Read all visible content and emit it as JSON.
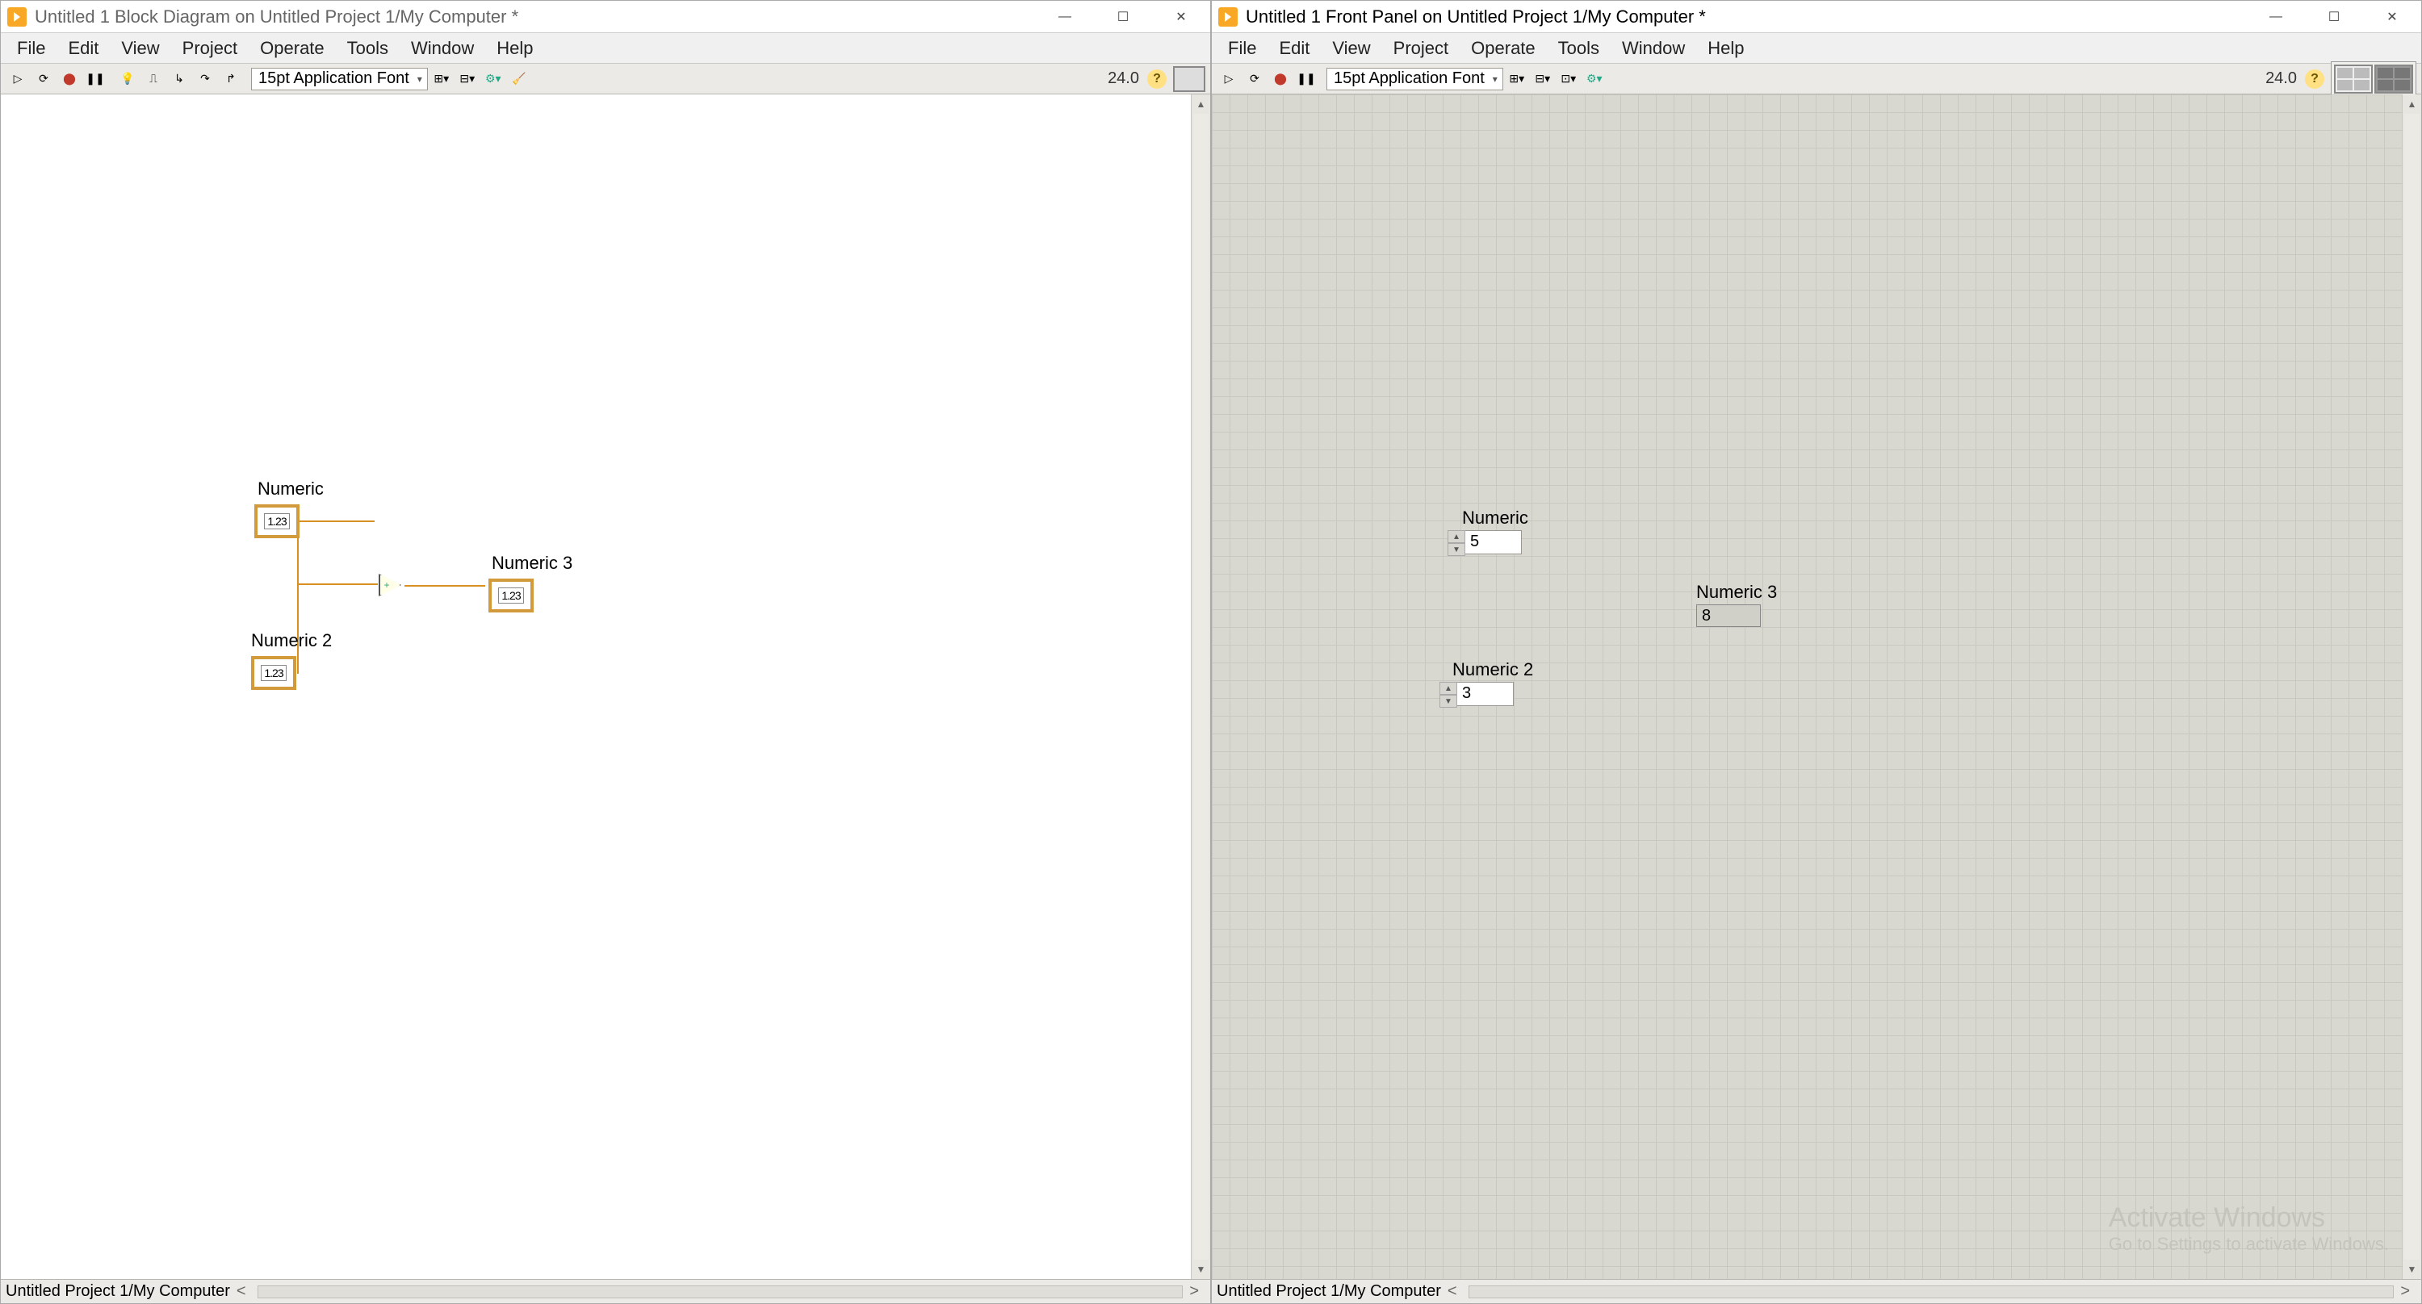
{
  "block_diagram": {
    "title": "Untitled 1 Block Diagram on Untitled Project 1/My Computer *",
    "menu": [
      "File",
      "Edit",
      "View",
      "Project",
      "Operate",
      "Tools",
      "Window",
      "Help"
    ],
    "font": "15pt Application Font",
    "version": "24.0",
    "status_path": "Untitled Project 1/My Computer",
    "nodes": {
      "n1": {
        "label": "Numeric",
        "display": "1.23"
      },
      "n2": {
        "label": "Numeric 2",
        "display": "1.23"
      },
      "n3": {
        "label": "Numeric 3",
        "display": "1.23"
      }
    }
  },
  "front_panel": {
    "title": "Untitled 1 Front Panel on Untitled Project 1/My Computer *",
    "menu": [
      "File",
      "Edit",
      "View",
      "Project",
      "Operate",
      "Tools",
      "Window",
      "Help"
    ],
    "font": "15pt Application Font",
    "version": "24.0",
    "status_path": "Untitled Project 1/My Computer",
    "controls": {
      "c1": {
        "label": "Numeric",
        "value": "5"
      },
      "c2": {
        "label": "Numeric 2",
        "value": "3"
      },
      "ind": {
        "label": "Numeric 3",
        "value": "8"
      }
    },
    "watermark": {
      "line1": "Activate Windows",
      "line2": "Go to Settings to activate Windows."
    }
  }
}
